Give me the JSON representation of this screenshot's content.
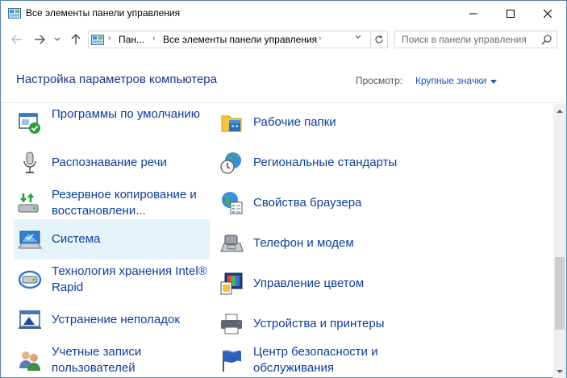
{
  "window": {
    "title": "Все элементы панели управления"
  },
  "navigation": {
    "breadcrumb": [
      "Пан...",
      "Все элементы панели управления"
    ],
    "search_placeholder": "Поиск в панели управления"
  },
  "header": {
    "title": "Настройка параметров компьютера",
    "view_label": "Просмотр:",
    "view_value": "Крупные значки"
  },
  "items": {
    "left": [
      {
        "label": "Программы по умолчанию",
        "icon": "default-programs-icon",
        "selected": false
      },
      {
        "label": "Распознавание речи",
        "icon": "microphone-icon",
        "selected": false
      },
      {
        "label": "Резервное копирование и восстановлени...",
        "icon": "backup-restore-icon",
        "selected": false
      },
      {
        "label": "Система",
        "icon": "system-monitor-icon",
        "selected": true
      },
      {
        "label": "Технология хранения Intel® Rapid",
        "icon": "intel-rapid-storage-icon",
        "selected": false
      },
      {
        "label": "Устранение неполадок",
        "icon": "troubleshooting-icon",
        "selected": false
      },
      {
        "label": "Учетные записи пользователей",
        "icon": "user-accounts-icon",
        "selected": false
      }
    ],
    "right": [
      {
        "label": "Рабочие папки",
        "icon": "work-folders-icon",
        "selected": false
      },
      {
        "label": "Региональные стандарты",
        "icon": "globe-clock-icon",
        "selected": false
      },
      {
        "label": "Свойства браузера",
        "icon": "internet-options-icon",
        "selected": false
      },
      {
        "label": "Телефон и модем",
        "icon": "phone-modem-icon",
        "selected": false
      },
      {
        "label": "Управление цветом",
        "icon": "color-management-icon",
        "selected": false
      },
      {
        "label": "Устройства и принтеры",
        "icon": "printer-icon",
        "selected": false
      },
      {
        "label": "Центр безопасности и обслуживания",
        "icon": "security-flag-icon",
        "selected": false
      }
    ]
  },
  "colors": {
    "link": "#0d3d9c",
    "title": "#1e3287",
    "selection": "#e5f3fb"
  }
}
